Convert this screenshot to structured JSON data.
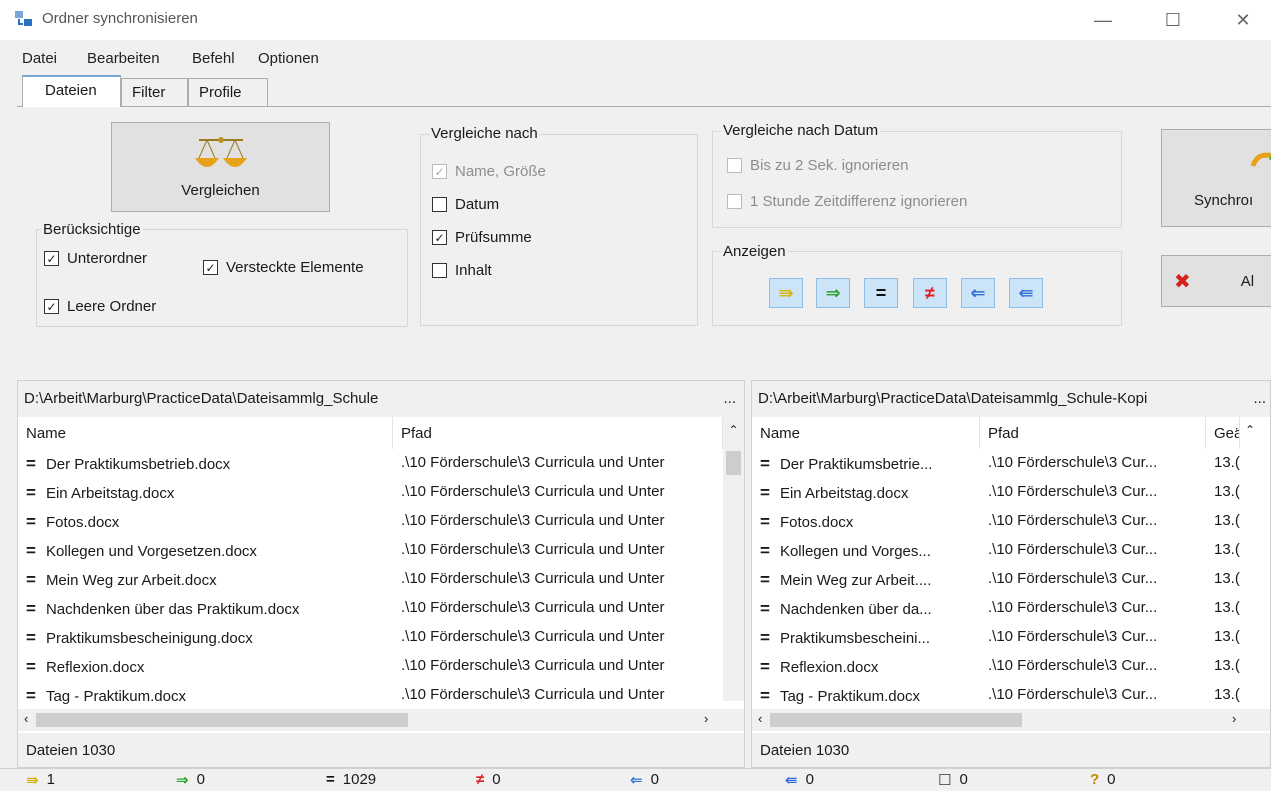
{
  "window": {
    "title": "Ordner synchronisieren",
    "minimize_glyph": "—",
    "maximize_glyph": "☐",
    "close_glyph": "✕"
  },
  "menu": [
    "Datei",
    "Bearbeiten",
    "Befehl",
    "Optionen"
  ],
  "tabs": [
    "Dateien",
    "Filter",
    "Profile"
  ],
  "compare_button": "Vergleichen",
  "consider": {
    "label": "Berücksichtige",
    "subfolders": "Unterordner",
    "hidden": "Versteckte Elemente",
    "empty": "Leere Ordner"
  },
  "compare_by": {
    "label": "Vergleiche nach",
    "name_size": "Name, Größe",
    "date": "Datum",
    "checksum": "Prüfsumme",
    "content": "Inhalt"
  },
  "compare_date": {
    "label": "Vergleiche nach Datum",
    "ignore_2s": "Bis zu 2 Sek. ignorieren",
    "ignore_1h": "1 Stunde Zeitdifferenz ignorieren"
  },
  "show": {
    "label": "Anzeigen",
    "icons": [
      "⇛",
      "⇒",
      "=",
      "≠",
      "⇐",
      "⇚"
    ],
    "colors": [
      "#d8b400",
      "#2aa02a",
      "#111111",
      "#e0201e",
      "#2f6fd6",
      "#2f6fd6"
    ]
  },
  "sync_button": "Synchroı",
  "abort_button": "Al",
  "left_pane": {
    "path": "D:\\Arbeit\\Marburg\\PracticeData\\Dateisammlg_Schule",
    "more": "...",
    "col_name": "Name",
    "col_path": "Pfad",
    "rows": [
      {
        "name": "Der Praktikumsbetrieb.docx",
        "path": ".\\10 Förderschule\\3 Curricula und Unter"
      },
      {
        "name": "Ein Arbeitstag.docx",
        "path": ".\\10 Förderschule\\3 Curricula und Unter"
      },
      {
        "name": "Fotos.docx",
        "path": ".\\10 Förderschule\\3 Curricula und Unter"
      },
      {
        "name": "Kollegen und Vorgesetzen.docx",
        "path": ".\\10 Förderschule\\3 Curricula und Unter"
      },
      {
        "name": "Mein Weg zur Arbeit.docx",
        "path": ".\\10 Förderschule\\3 Curricula und Unter"
      },
      {
        "name": "Nachdenken über das Praktikum.docx",
        "path": ".\\10 Förderschule\\3 Curricula und Unter"
      },
      {
        "name": "Praktikumsbescheinigung.docx",
        "path": ".\\10 Förderschule\\3 Curricula und Unter"
      },
      {
        "name": "Reflexion.docx",
        "path": ".\\10 Förderschule\\3 Curricula und Unter"
      },
      {
        "name": "Tag -  Praktikum.docx",
        "path": ".\\10 Förderschule\\3 Curricula und Unter"
      }
    ],
    "status": "Dateien 1030"
  },
  "right_pane": {
    "path": "D:\\Arbeit\\Marburg\\PracticeData\\Dateisammlg_Schule-Kopi",
    "more": "...",
    "col_name": "Name",
    "col_path": "Pfad",
    "col_changed": "Geä",
    "rows": [
      {
        "name": "Der Praktikumsbetrie...",
        "path": ".\\10 Förderschule\\3 Cur...",
        "changed": "13.("
      },
      {
        "name": "Ein Arbeitstag.docx",
        "path": ".\\10 Förderschule\\3 Cur...",
        "changed": "13.("
      },
      {
        "name": "Fotos.docx",
        "path": ".\\10 Förderschule\\3 Cur...",
        "changed": "13.("
      },
      {
        "name": "Kollegen und Vorges...",
        "path": ".\\10 Förderschule\\3 Cur...",
        "changed": "13.("
      },
      {
        "name": "Mein Weg zur Arbeit....",
        "path": ".\\10 Förderschule\\3 Cur...",
        "changed": "13.("
      },
      {
        "name": "Nachdenken über da...",
        "path": ".\\10 Förderschule\\3 Cur...",
        "changed": "13.("
      },
      {
        "name": "Praktikumsbescheini...",
        "path": ".\\10 Förderschule\\3 Cur...",
        "changed": "13.("
      },
      {
        "name": "Reflexion.docx",
        "path": ".\\10 Förderschule\\3 Cur...",
        "changed": "13.("
      },
      {
        "name": "Tag -  Praktikum.docx",
        "path": ".\\10 Förderschule\\3 Cur...",
        "changed": "13.("
      }
    ],
    "status": "Dateien 1030"
  },
  "row_icon": "=",
  "bottom_status": [
    {
      "icon": "⇛",
      "value": "1",
      "color": "#d8b400"
    },
    {
      "icon": "⇒",
      "value": "0",
      "color": "#2aa02a"
    },
    {
      "icon": "=",
      "value": "1029",
      "color": "#111111"
    },
    {
      "icon": "≠",
      "value": "0",
      "color": "#e0201e"
    },
    {
      "icon": "⇐",
      "value": "0",
      "color": "#2f6fd6"
    },
    {
      "icon": "⇚",
      "value": "0",
      "color": "#2f6fd6"
    },
    {
      "icon": "☐",
      "value": "0",
      "color": "#333333"
    },
    {
      "icon": "?",
      "value": "0",
      "color": "#c58a00"
    }
  ]
}
